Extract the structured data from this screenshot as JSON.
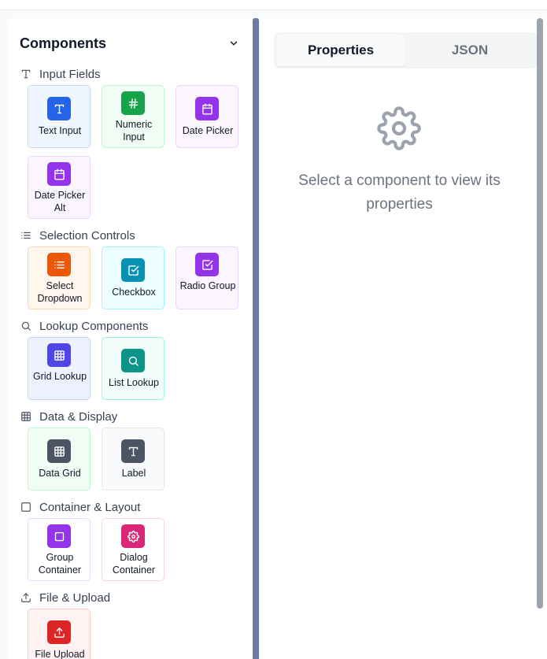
{
  "panel": {
    "title": "Components"
  },
  "sections": [
    {
      "label": "Input Fields",
      "icon": "type-icon"
    },
    {
      "label": "Selection Controls",
      "icon": "list-icon"
    },
    {
      "label": "Lookup Components",
      "icon": "search-icon"
    },
    {
      "label": "Data & Display",
      "icon": "table-icon"
    },
    {
      "label": "Container & Layout",
      "icon": "square-icon"
    },
    {
      "label": "File & Upload",
      "icon": "upload-icon"
    }
  ],
  "components": {
    "text_input": {
      "label": "Text Input",
      "icon": "type-icon",
      "color": "#2563eb"
    },
    "numeric_input": {
      "label": "Numeric Input",
      "icon": "hash-icon",
      "color": "#16a34a"
    },
    "date_picker": {
      "label": "Date Picker",
      "icon": "calendar-icon",
      "color": "#9333ea"
    },
    "date_picker_alt": {
      "label": "Date Picker Alt",
      "icon": "calendar-icon",
      "color": "#9333ea"
    },
    "select_dropdown": {
      "label": "Select Dropdown",
      "icon": "list-icon",
      "color": "#ea580c"
    },
    "checkbox": {
      "label": "Checkbox",
      "icon": "check-square-icon",
      "color": "#0891b2"
    },
    "radio_group": {
      "label": "Radio Group",
      "icon": "check-square-icon",
      "color": "#9333ea"
    },
    "grid_lookup": {
      "label": "Grid Lookup",
      "icon": "table-icon",
      "color": "#4f46e5"
    },
    "list_lookup": {
      "label": "List Lookup",
      "icon": "search-icon",
      "color": "#0d9488"
    },
    "data_grid": {
      "label": "Data Grid",
      "icon": "table-icon",
      "color": "#4b5563"
    },
    "label": {
      "label": "Label",
      "icon": "type-icon",
      "color": "#4b5563"
    },
    "group_container": {
      "label": "Group Container",
      "icon": "square-icon",
      "color": "#9333ea"
    },
    "dialog_container": {
      "label": "Dialog Container",
      "icon": "gear-icon",
      "color": "#db2777"
    },
    "file_upload": {
      "label": "File Upload",
      "icon": "upload-icon",
      "color": "#dc2626"
    }
  },
  "tabs": [
    {
      "label": "Properties",
      "active": true
    },
    {
      "label": "JSON",
      "active": false
    }
  ],
  "empty_state": {
    "message": "Select a component to view its properties",
    "icon": "gear-icon"
  }
}
